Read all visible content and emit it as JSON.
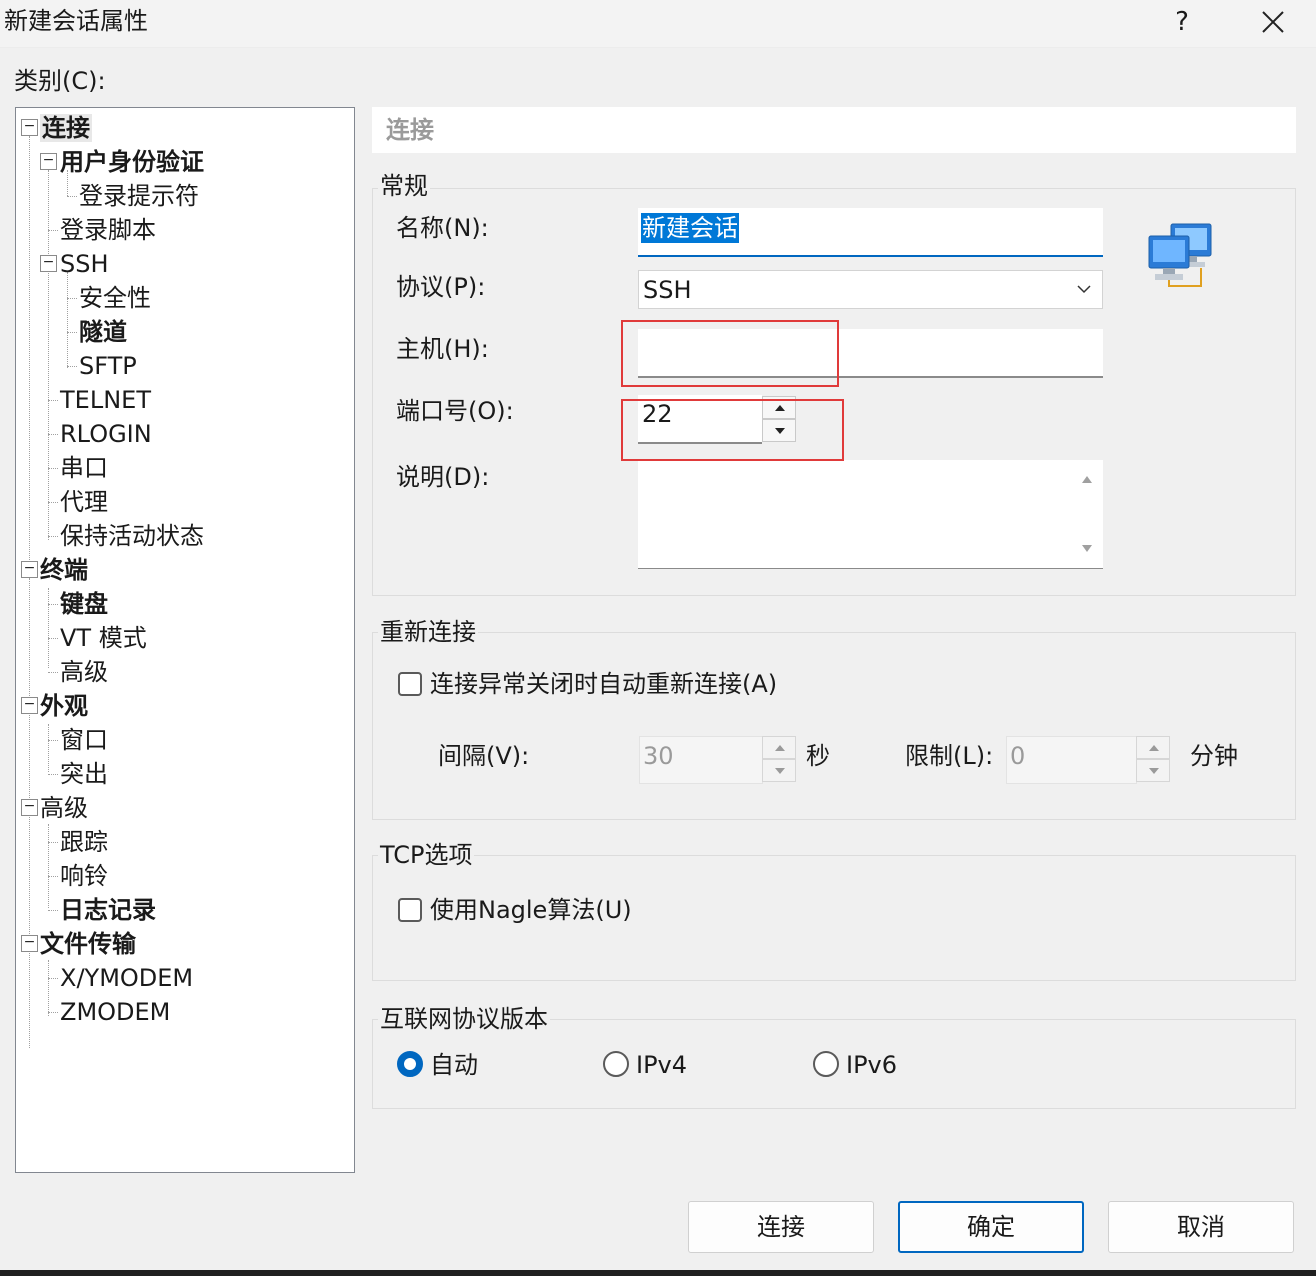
{
  "window": {
    "title": "新建会话属性",
    "help_label": "?"
  },
  "category_label": "类别(C):",
  "tree": {
    "items": [
      {
        "label": "连接",
        "bold": true,
        "selected": true
      },
      {
        "label": "用户身份验证",
        "bold": true
      },
      {
        "label": "登录提示符"
      },
      {
        "label": "登录脚本"
      },
      {
        "label": "SSH"
      },
      {
        "label": "安全性"
      },
      {
        "label": "隧道",
        "bold": true
      },
      {
        "label": "SFTP"
      },
      {
        "label": "TELNET"
      },
      {
        "label": "RLOGIN"
      },
      {
        "label": "串口"
      },
      {
        "label": "代理"
      },
      {
        "label": "保持活动状态"
      },
      {
        "label": "终端",
        "bold": true
      },
      {
        "label": "键盘",
        "bold": true
      },
      {
        "label": "VT 模式"
      },
      {
        "label": "高级"
      },
      {
        "label": "外观",
        "bold": true
      },
      {
        "label": "窗口"
      },
      {
        "label": "突出"
      },
      {
        "label": "高级"
      },
      {
        "label": "跟踪"
      },
      {
        "label": "响铃"
      },
      {
        "label": "日志记录",
        "bold": true
      },
      {
        "label": "文件传输",
        "bold": true
      },
      {
        "label": "X/YMODEM"
      },
      {
        "label": "ZMODEM"
      }
    ],
    "toggle_symbol": "−"
  },
  "section_header": "连接",
  "general": {
    "title": "常规",
    "name_label": "名称(N):",
    "name_value": "新建会话",
    "protocol_label": "协议(P):",
    "protocol_value": "SSH",
    "host_label": "主机(H):",
    "host_value": "",
    "port_label": "端口号(O):",
    "port_value": "22",
    "description_label": "说明(D):",
    "description_value": ""
  },
  "reconnect": {
    "title": "重新连接",
    "checkbox_label": "连接异常关闭时自动重新连接(A)",
    "checked": false,
    "interval_label": "间隔(V):",
    "interval_value": "30",
    "interval_unit": "秒",
    "limit_label": "限制(L):",
    "limit_value": "0",
    "limit_unit": "分钟"
  },
  "tcp": {
    "title": "TCP选项",
    "nagle_label": "使用Nagle算法(U)",
    "checked": false
  },
  "ip_version": {
    "title": "互联网协议版本",
    "options": [
      "自动",
      "IPv4",
      "IPv6"
    ],
    "selected": "自动"
  },
  "buttons": {
    "connect": "连接",
    "ok": "确定",
    "cancel": "取消"
  },
  "colors": {
    "accent": "#0067c0",
    "highlight_box": "#e03a3a"
  }
}
